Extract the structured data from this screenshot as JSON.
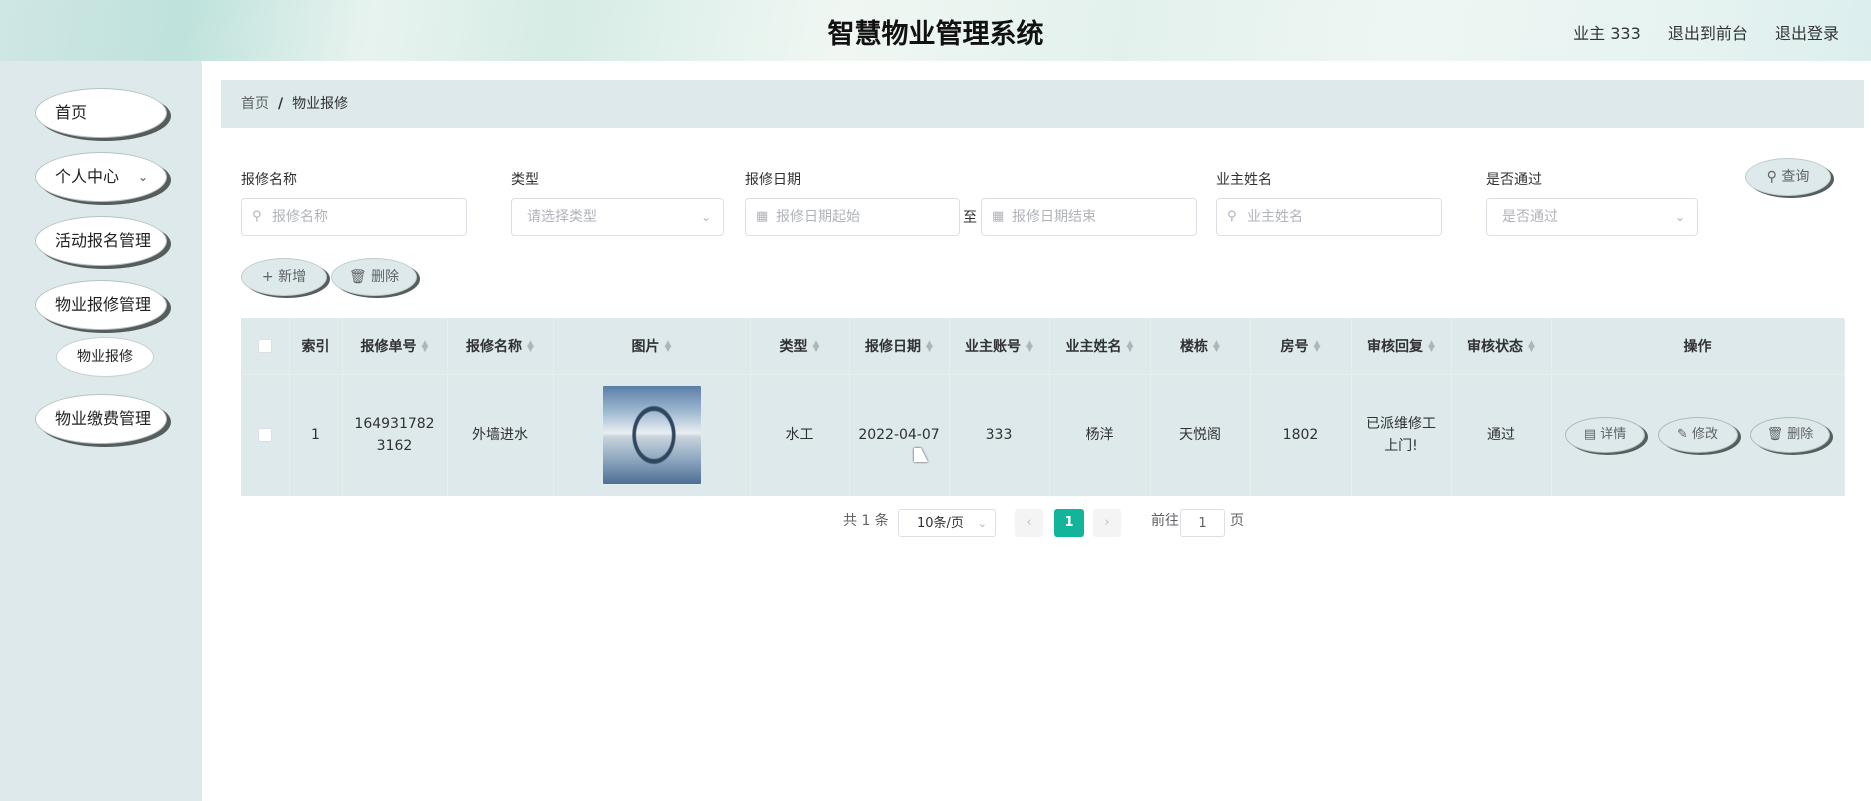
{
  "header": {
    "title": "智慧物业管理系统",
    "user": "业主 333",
    "exit_front": "退出到前台",
    "logout": "退出登录"
  },
  "sidebar": {
    "items": [
      {
        "label": "首页"
      },
      {
        "label": "个人中心"
      },
      {
        "label": "活动报名管理"
      },
      {
        "label": "物业报修管理"
      },
      {
        "label": "物业缴费管理"
      }
    ],
    "sub_item": "物业报修"
  },
  "breadcrumb": {
    "home": "首页",
    "sep": "/",
    "current": "物业报修"
  },
  "search": {
    "name_label": "报修名称",
    "name_placeholder": "报修名称",
    "type_label": "类型",
    "type_placeholder": "请选择类型",
    "date_label": "报修日期",
    "date_start": "报修日期起始",
    "date_to": "至",
    "date_end": "报修日期结束",
    "owner_label": "业主姓名",
    "owner_placeholder": "业主姓名",
    "pass_label": "是否通过",
    "pass_placeholder": "是否通过",
    "query": "查询"
  },
  "toolbar": {
    "add": "新增",
    "delete": "删除"
  },
  "table": {
    "headers": [
      "索引",
      "报修单号",
      "报修名称",
      "图片",
      "类型",
      "报修日期",
      "业主账号",
      "业主姓名",
      "楼栋",
      "房号",
      "审核回复",
      "审核状态",
      "操作"
    ],
    "rows": [
      {
        "index": "1",
        "order_no": "1649317823162",
        "name": "外墙进水",
        "type": "水工",
        "date": "2022-04-07",
        "account": "333",
        "owner": "杨洋",
        "building": "天悦阁",
        "room": "1802",
        "reply": "已派维修工上门!",
        "status": "通过",
        "actions": [
          "详情",
          "修改",
          "删除"
        ]
      }
    ]
  },
  "pagination": {
    "total": "共 1 条",
    "page_size": "10条/页",
    "current": "1",
    "goto_label": "前往",
    "goto_value": "1",
    "page_suffix": "页"
  },
  "colors": {
    "accent": "#13b59a",
    "panel": "#dde9ea"
  }
}
